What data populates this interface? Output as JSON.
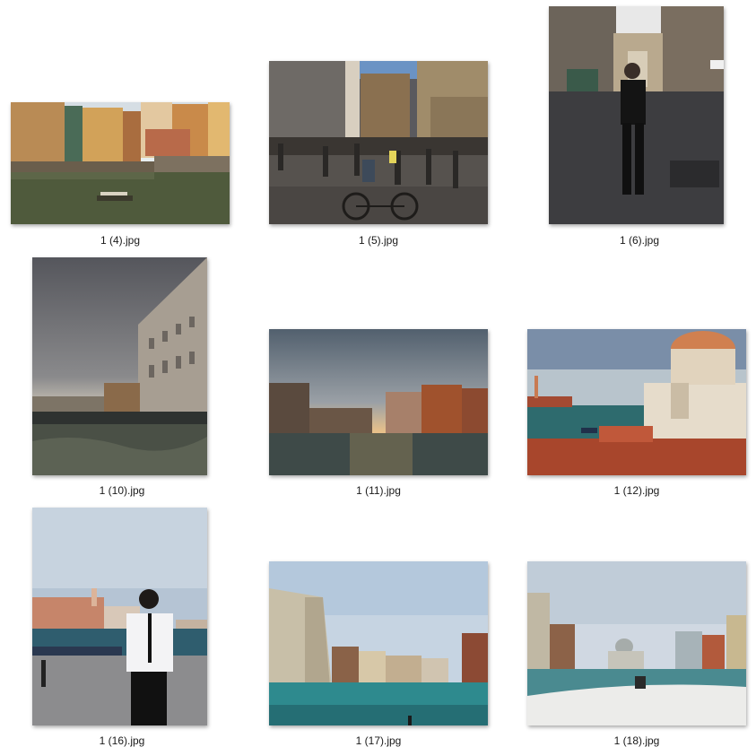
{
  "files": [
    {
      "name": "1 (4).jpg"
    },
    {
      "name": "1 (5).jpg"
    },
    {
      "name": "1 (6).jpg"
    },
    {
      "name": "1 (10).jpg"
    },
    {
      "name": "1 (11).jpg"
    },
    {
      "name": "1 (12).jpg"
    },
    {
      "name": "1 (16).jpg"
    },
    {
      "name": "1 (17).jpg"
    },
    {
      "name": "1 (18).jpg"
    }
  ]
}
